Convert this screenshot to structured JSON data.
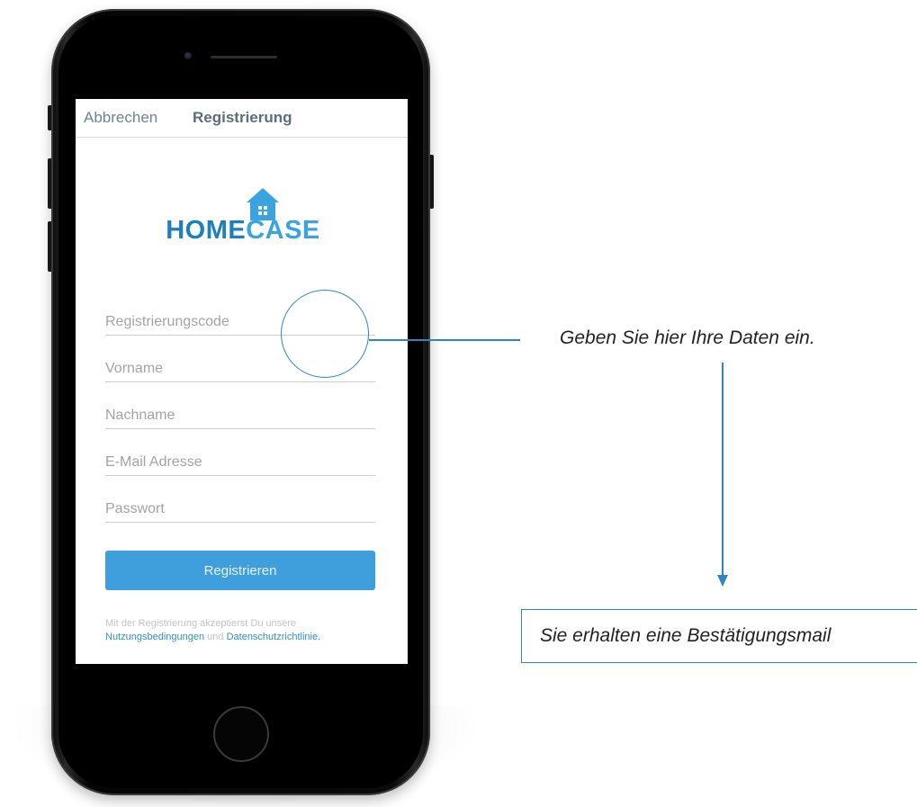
{
  "nav": {
    "cancel_label": "Abbrechen",
    "title": "Registrierung"
  },
  "logo": {
    "part1": "HOME",
    "part2": "CASE"
  },
  "form": {
    "registration_code_placeholder": "Registrierungscode",
    "first_name_placeholder": "Vorname",
    "last_name_placeholder": "Nachname",
    "email_placeholder": "E-Mail Adresse",
    "password_placeholder": "Passwort",
    "submit_label": "Registrieren"
  },
  "terms": {
    "prefix": "Mit der Registrierung akzeptierst Du unsere",
    "terms_link": "Nutzungsbedingungen",
    "conjunction": "und",
    "privacy_link": "Datenschutzrichtlinie."
  },
  "annotations": {
    "hint_enter_data": "Geben Sie hier Ihre Daten ein.",
    "hint_confirmation": "Sie erhalten eine Bestätigungsmail"
  },
  "colors": {
    "accent": "#3f9fdc",
    "annotation": "#2e86c1",
    "logo_dark": "#1d7fbe",
    "logo_light": "#39a4e0"
  }
}
